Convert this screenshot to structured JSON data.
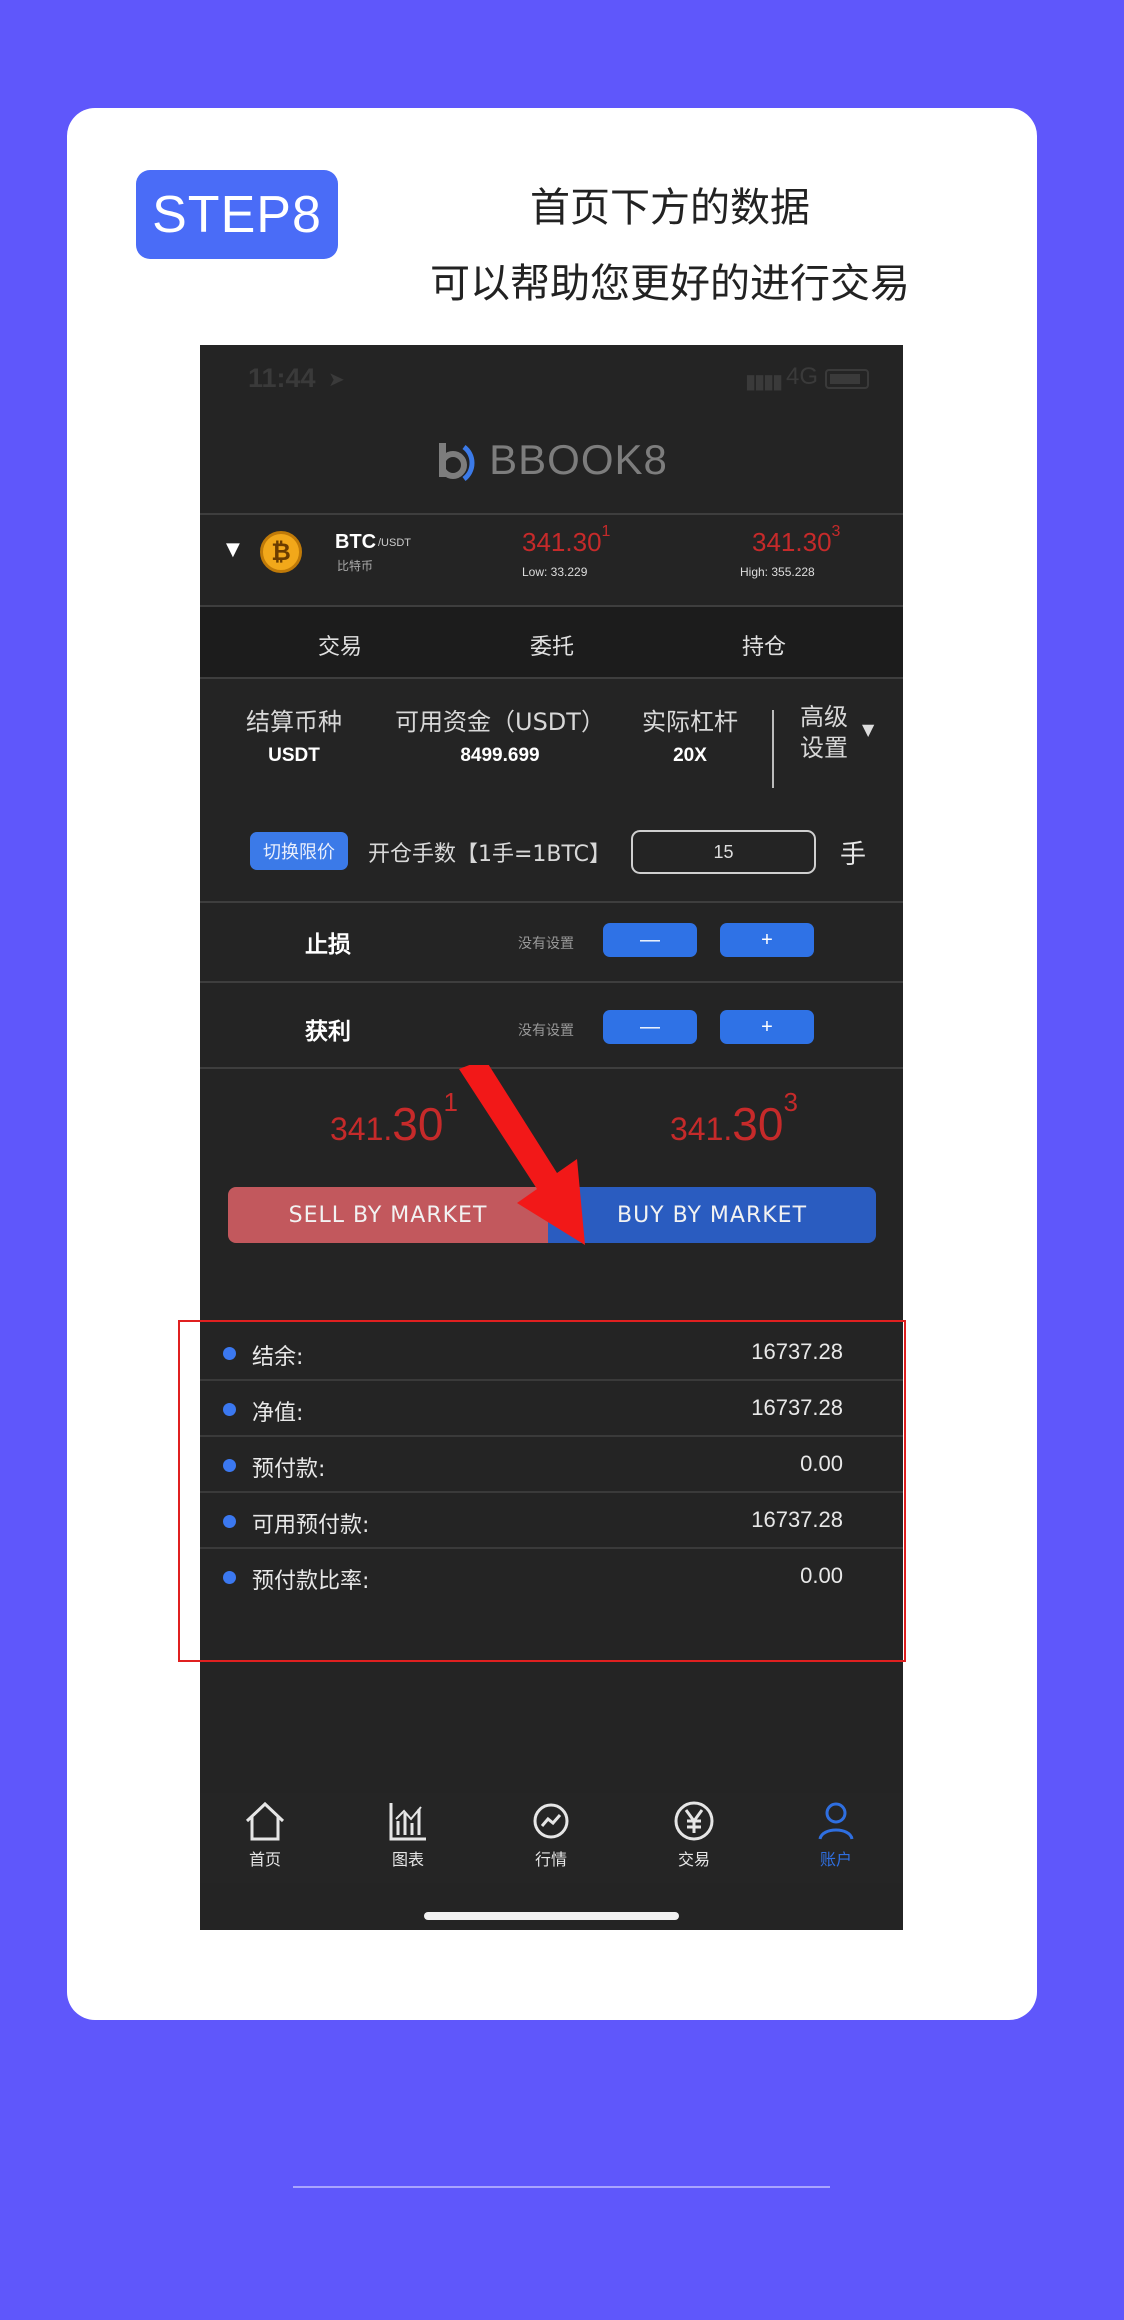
{
  "step": {
    "label": "STEP8"
  },
  "headline": {
    "line1": "首页下方的数据",
    "line2": "可以帮助您更好的进行交易"
  },
  "phone": {
    "status": {
      "time": "11:44",
      "network": "4G"
    },
    "brand": {
      "name": "BBOOK8"
    },
    "ticker": {
      "symbol": "BTC",
      "pair": "/USDT",
      "name_cn": "比特币",
      "bid": "341.30",
      "bid_sup": "1",
      "low": "Low: 33.229",
      "ask": "341.30",
      "ask_sup": "3",
      "high": "High:  355.228"
    },
    "tabs": [
      "交易",
      "委托",
      "持仓"
    ],
    "settings": {
      "currency_label": "结算币种",
      "currency_value": "USDT",
      "funds_label": "可用资金（USDT）",
      "funds_value": "8499.699",
      "leverage_label": "实际杠杆",
      "leverage_value": "20X",
      "advanced_line1": "高级",
      "advanced_line2": "设置"
    },
    "lots": {
      "switch_label": "切换限价",
      "label": "开仓手数【1手=1BTC】",
      "value": "15",
      "unit": "手"
    },
    "stop_loss": {
      "label": "止损",
      "hint": "没有设置",
      "minus": "—",
      "plus": "+"
    },
    "take_profit": {
      "label": "获利",
      "hint": "没有设置",
      "minus": "—",
      "plus": "+"
    },
    "sell": {
      "price_main": "341.",
      "price_big": "30",
      "sup": "1",
      "label": "SELL BY MARKET"
    },
    "buy": {
      "price_main": "341.",
      "price_big": "30",
      "sup": "3",
      "label": "BUY BY MARKET"
    },
    "account": [
      {
        "label": "结余:",
        "value": "16737.28"
      },
      {
        "label": "净值:",
        "value": "16737.28"
      },
      {
        "label": "预付款:",
        "value": "0.00"
      },
      {
        "label": "可用预付款:",
        "value": "16737.28"
      },
      {
        "label": "预付款比率:",
        "value": "0.00"
      }
    ],
    "nav": [
      {
        "label": "首页",
        "icon": "home-icon"
      },
      {
        "label": "图表",
        "icon": "chart-icon"
      },
      {
        "label": "行情",
        "icon": "market-icon"
      },
      {
        "label": "交易",
        "icon": "yen-icon"
      },
      {
        "label": "账户",
        "icon": "account-icon",
        "active": true
      }
    ]
  },
  "colors": {
    "background": "#5f57fb",
    "accent": "#4a6cf7",
    "price_red": "#c62a2a",
    "highlight_box": "#e02020"
  }
}
